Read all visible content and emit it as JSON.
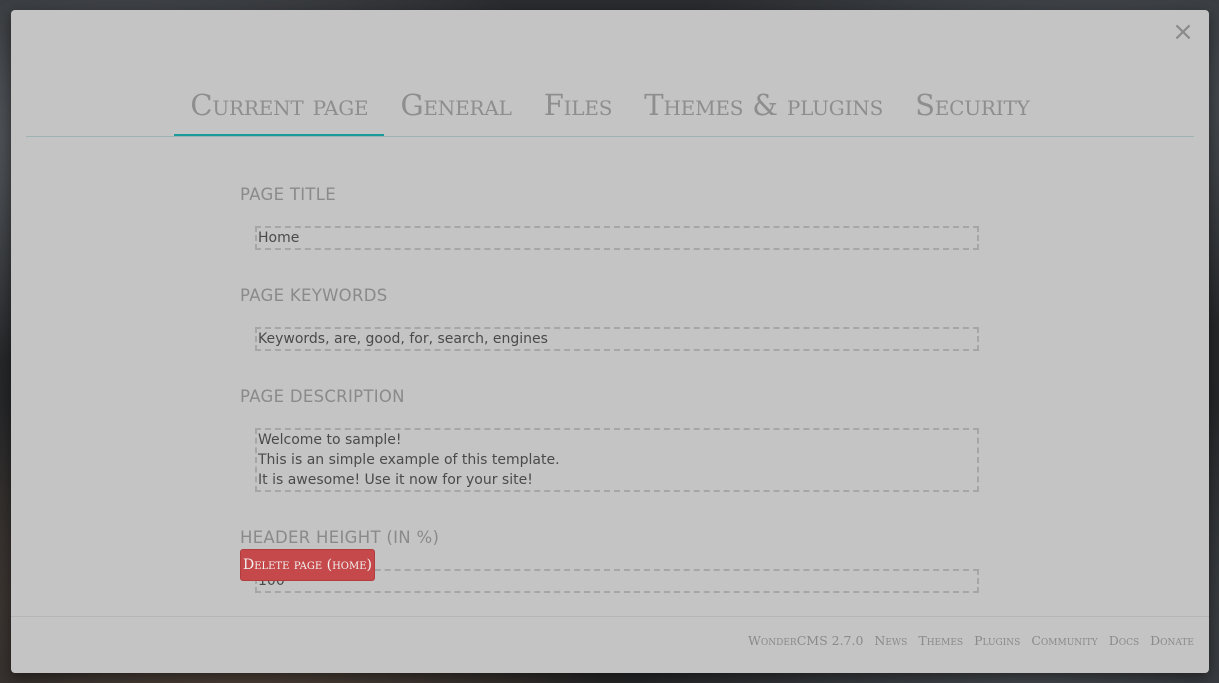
{
  "modal": {
    "close_icon": "close-icon",
    "close_glyph": "×"
  },
  "tabs": [
    {
      "label": "Current page",
      "active": true
    },
    {
      "label": "General",
      "active": false
    },
    {
      "label": "Files",
      "active": false
    },
    {
      "label": "Themes & plugins",
      "active": false
    },
    {
      "label": "Security",
      "active": false
    }
  ],
  "form": {
    "page_title": {
      "label": "PAGE TITLE",
      "value": "Home"
    },
    "page_keywords": {
      "label": "PAGE KEYWORDS",
      "value": "Keywords, are, good, for, search, engines"
    },
    "page_description": {
      "label": "PAGE DESCRIPTION",
      "value": "Welcome to sample!\nThis is an simple example of this template.\nIt is awesome! Use it now for your site!"
    },
    "header_height": {
      "label": "HEADER HEIGHT (IN %)",
      "value": "100"
    }
  },
  "delete_button": {
    "label": "Delete page (home)"
  },
  "footer": {
    "brand": "WonderCMS 2.7.0",
    "links": [
      "News",
      "Themes",
      "Plugins",
      "Community",
      "Docs",
      "Donate"
    ]
  },
  "colors": {
    "modal_bg": "#c4c4c4",
    "active_tab_underline": "#1a9c9c",
    "delete_button": "#c5484a"
  }
}
